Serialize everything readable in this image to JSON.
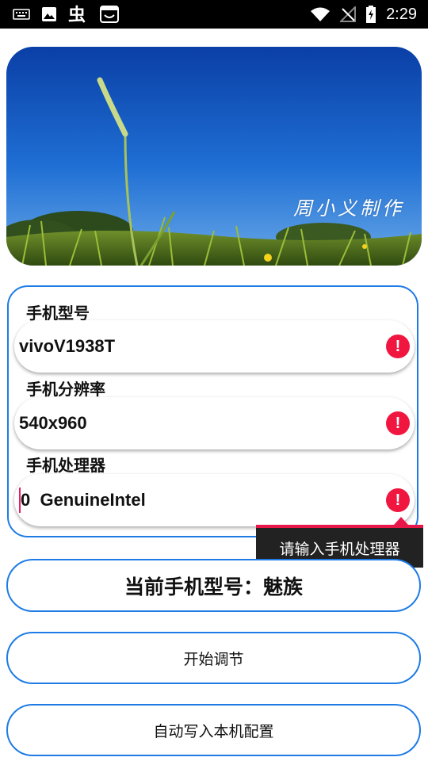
{
  "status_bar": {
    "time": "2:29",
    "left_icons": [
      "keyboard-icon",
      "image-icon",
      "bug-icon",
      "screenshot-icon"
    ],
    "right_icons": [
      "wifi-icon",
      "no-signal-icon",
      "battery-charging-icon"
    ]
  },
  "banner": {
    "caption": "周小义制作"
  },
  "form": {
    "fields": [
      {
        "label": "手机型号",
        "value": "vivoV1938T"
      },
      {
        "label": "手机分辨率",
        "value": "540x960"
      },
      {
        "label": "手机处理器",
        "value": "0  GenuineIntel"
      }
    ],
    "error_glyph": "!"
  },
  "tooltip": {
    "text": "请输入手机处理器"
  },
  "buttons": {
    "current_model": "当前手机型号：魅族",
    "start": "开始调节",
    "write_config": "自动写入本机配置"
  },
  "colors": {
    "accent_blue": "#1e7be6",
    "error_red": "#f0163f",
    "tooltip_bg": "#222222"
  }
}
